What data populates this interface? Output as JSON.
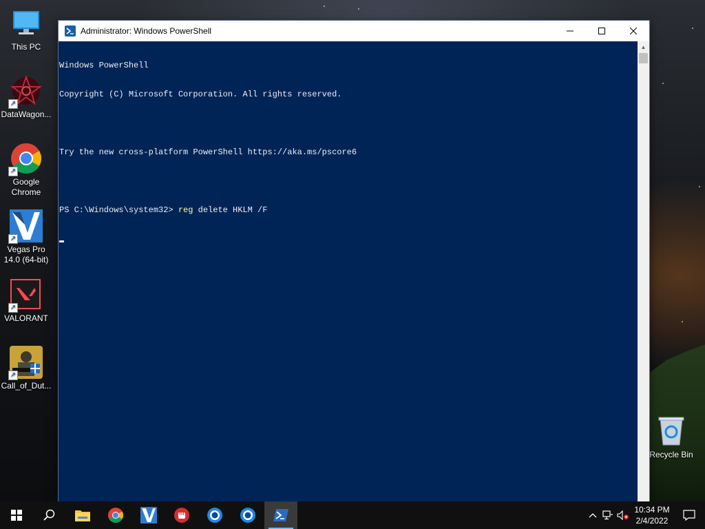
{
  "desktop": {
    "icons": [
      {
        "label": "This PC",
        "icon": "computer-icon"
      },
      {
        "label": "DataWagon...",
        "icon": "datawagon-icon"
      },
      {
        "label": "Google Chrome",
        "icon": "chrome-icon"
      },
      {
        "label": "Vegas Pro 14.0 (64-bit)",
        "icon": "vegas-icon"
      },
      {
        "label": "VALORANT",
        "icon": "valorant-icon"
      },
      {
        "label": "Call_of_Dut...",
        "icon": "call-of-duty-icon"
      },
      {
        "label": "Recycle Bin",
        "icon": "recycle-bin-icon"
      }
    ]
  },
  "window": {
    "title": "Administrator: Windows PowerShell",
    "console_lines": [
      "Windows PowerShell",
      "Copyright (C) Microsoft Corporation. All rights reserved.",
      "",
      "Try the new cross-platform PowerShell https://aka.ms/pscore6",
      ""
    ],
    "prompt": "PS C:\\Windows\\system32> ",
    "command_keyword": "reg",
    "command_args": " delete HKLM /F"
  },
  "taskbar": {
    "items": [
      "start-icon",
      "search-icon",
      "file-explorer-icon",
      "chrome-icon",
      "vegas-icon",
      "fist-app-icon",
      "app-icon-1",
      "app-icon-2",
      "powershell-icon"
    ],
    "active_item": "powershell-icon"
  },
  "tray": {
    "time": "10:34 PM",
    "date": "2/4/2022"
  },
  "colors": {
    "console_bg": "#012456",
    "console_text": "#eeedf0",
    "command_highlight": "#ffff9e",
    "taskbar_bg": "#101010",
    "accent": "#76b9ed"
  }
}
